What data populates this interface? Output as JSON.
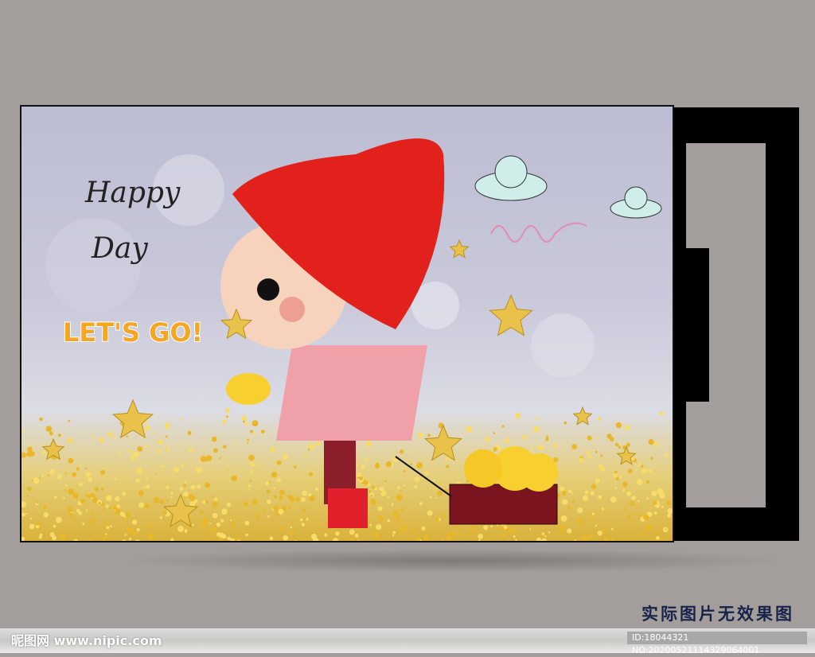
{
  "artwork": {
    "handwriting_top": "Happy",
    "handwriting_bottom": "Day",
    "slogan": "LET'S GO!",
    "slogan_colors": [
      "#f04d8c",
      "#f5a623",
      "#2fa6e0",
      "#f5a623",
      "#7ac143",
      "#f5a623",
      "#e94e4e",
      "#7ac143",
      "#f5a623"
    ]
  },
  "caption": "实际图片无效果图",
  "footer": {
    "site_logo": "昵图网 www.nipic.com",
    "id_text": "ID:18044321 NO:20200521114329064001"
  }
}
